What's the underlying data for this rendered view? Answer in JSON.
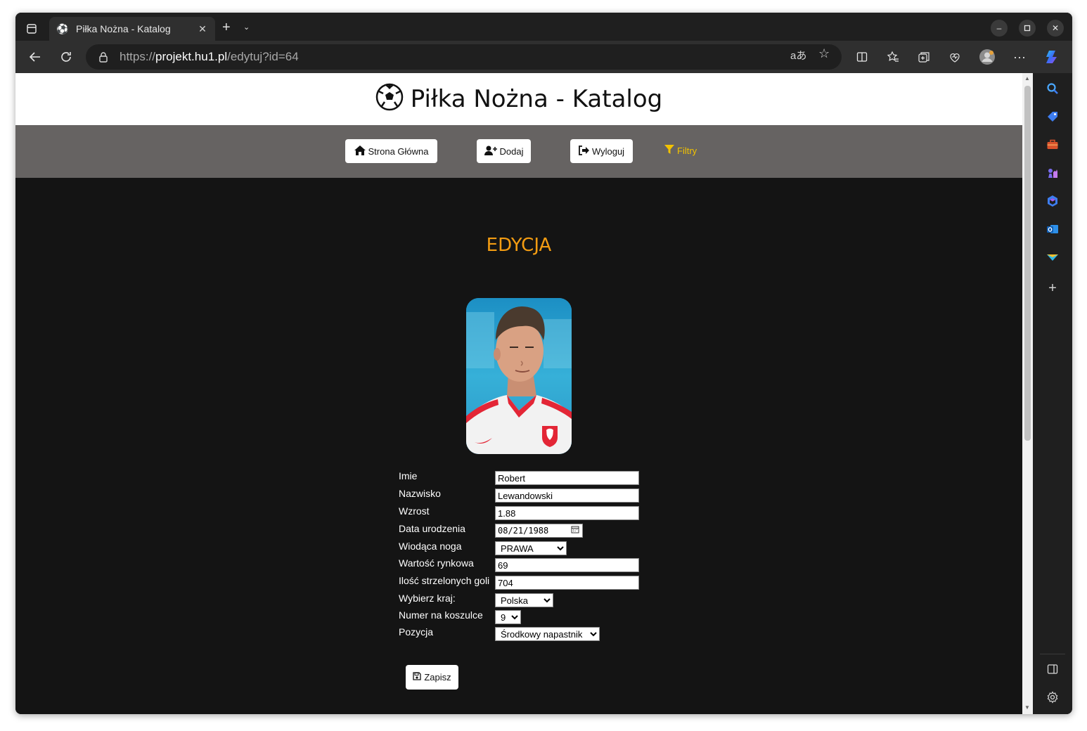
{
  "browser": {
    "tab": {
      "title": "Piłka Nożna - Katalog",
      "favicon": "⚽"
    },
    "address": {
      "scheme": "https://",
      "host": "projekt.hu1.pl",
      "path": "/edytuj?id=64"
    },
    "icons": [
      "tab-actions-icon",
      "close-icon",
      "new-tab-icon",
      "chevron-down-icon",
      "minimize-icon",
      "maximize-icon",
      "window-close-icon",
      "back-icon",
      "reload-icon",
      "lock-icon",
      "read-aloud-icon",
      "favorite-star-icon",
      "split-screen-icon",
      "favorites-icon",
      "collections-icon",
      "browser-essentials-icon",
      "profile-icon",
      "more-icon",
      "copilot-icon"
    ],
    "sidebar_icons": [
      "search-icon",
      "tag-icon",
      "toolbox-icon",
      "chess-icon",
      "copilot-app-icon",
      "outlook-icon",
      "send-icon",
      "add-icon",
      "sidebar-toggle-icon",
      "settings-icon"
    ]
  },
  "page": {
    "title": "Piłka Nożna - Katalog",
    "nav": {
      "home": "Strona Główna",
      "add": "Dodaj",
      "logout": "Wyloguj",
      "filters": "Filtry"
    },
    "heading": "EDYCJA",
    "form": {
      "first_name": {
        "label": "Imie",
        "value": "Robert"
      },
      "last_name": {
        "label": "Nazwisko",
        "value": "Lewandowski"
      },
      "height": {
        "label": "Wzrost",
        "value": "1.88"
      },
      "birth_date": {
        "label": "Data urodzenia",
        "value": "08/21/1988"
      },
      "foot": {
        "label": "Wiodąca noga",
        "value": "PRAWA"
      },
      "market_value": {
        "label": "Wartość rynkowa",
        "value": "69"
      },
      "goals": {
        "label": "Ilość strzelonych goli",
        "value": "704"
      },
      "country": {
        "label": "Wybierz kraj:",
        "value": "Polska"
      },
      "shirt_number": {
        "label": "Numer na koszulce",
        "value": "9"
      },
      "position": {
        "label": "Pozycja",
        "value": "Środkowy napastnik"
      }
    },
    "save_label": "Zapisz"
  },
  "colors": {
    "accent": "#f39c12",
    "filters": "#f2c200",
    "nav_bg": "#666362",
    "page_bg": "#141414"
  }
}
